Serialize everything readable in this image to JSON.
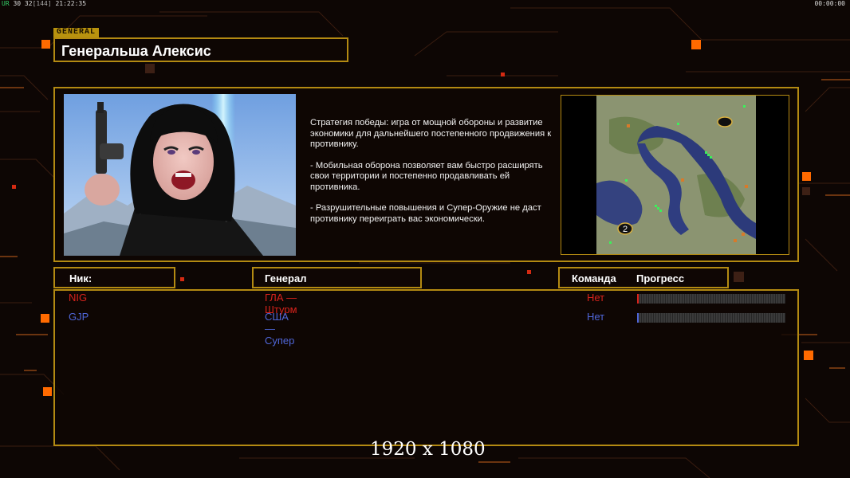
{
  "hud": {
    "flag": "UR",
    "fps": "30 32",
    "fps_bracket": "[144]",
    "clock": "21:22:35",
    "timer": "00:00:00"
  },
  "general_tag": "GENERAL",
  "general_name": "Генеральша Алексис",
  "description": [
    "Стратегия победы: игра от мощной обороны и развитие экономики для дальнейшего постепенного продвижения к противнику.",
    "- Мобильная оборона позволяет вам быстро расширять свои территории и постепенно продавливать ей противника.",
    "- Разрушительные повышения и Супер-Оружие не даст противнику переиграть вас экономически."
  ],
  "map": {
    "start_marker": "2"
  },
  "columns": {
    "nick": "Ник:",
    "general": "Генерал",
    "team": "Команда",
    "progress": "Прогресс"
  },
  "players": [
    {
      "nick": "NIG",
      "general": "ГЛА — Штурм",
      "team": "Нет",
      "progress": 0.01,
      "color": "#d8231c"
    },
    {
      "nick": "GJP",
      "general": "США — Супер",
      "team": "Нет",
      "progress": 0.01,
      "color": "#4f66d8"
    }
  ],
  "resolution": "1920 x 1080",
  "colors": {
    "frame": "#b38a12",
    "accent": "#ff6a00",
    "background": "#0d0604"
  }
}
